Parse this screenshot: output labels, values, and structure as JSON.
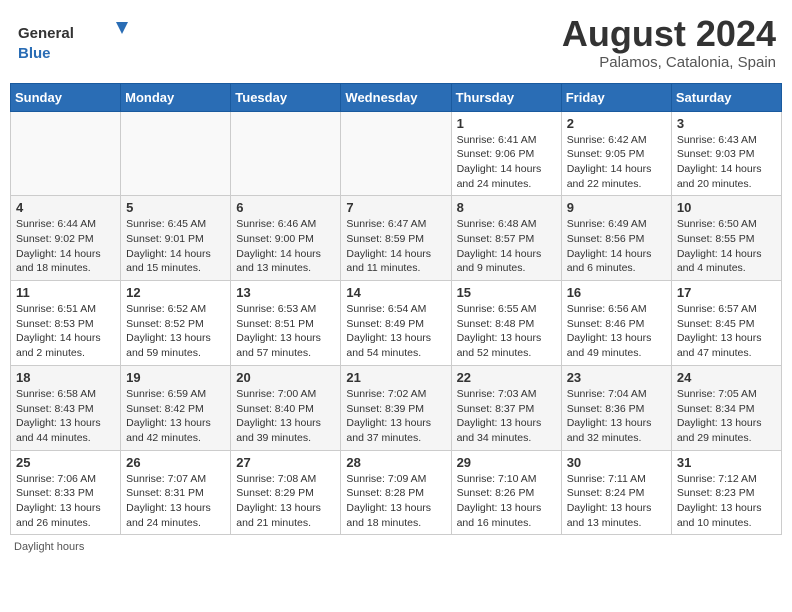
{
  "header": {
    "logo_general": "General",
    "logo_blue": "Blue",
    "month_year": "August 2024",
    "location": "Palamos, Catalonia, Spain"
  },
  "footer": {
    "daylight_label": "Daylight hours"
  },
  "days_of_week": [
    "Sunday",
    "Monday",
    "Tuesday",
    "Wednesday",
    "Thursday",
    "Friday",
    "Saturday"
  ],
  "weeks": [
    [
      {
        "num": "",
        "info": "",
        "empty": true
      },
      {
        "num": "",
        "info": "",
        "empty": true
      },
      {
        "num": "",
        "info": "",
        "empty": true
      },
      {
        "num": "",
        "info": "",
        "empty": true
      },
      {
        "num": "1",
        "info": "Sunrise: 6:41 AM\nSunset: 9:06 PM\nDaylight: 14 hours\nand 24 minutes.",
        "empty": false
      },
      {
        "num": "2",
        "info": "Sunrise: 6:42 AM\nSunset: 9:05 PM\nDaylight: 14 hours\nand 22 minutes.",
        "empty": false
      },
      {
        "num": "3",
        "info": "Sunrise: 6:43 AM\nSunset: 9:03 PM\nDaylight: 14 hours\nand 20 minutes.",
        "empty": false
      }
    ],
    [
      {
        "num": "4",
        "info": "Sunrise: 6:44 AM\nSunset: 9:02 PM\nDaylight: 14 hours\nand 18 minutes.",
        "empty": false
      },
      {
        "num": "5",
        "info": "Sunrise: 6:45 AM\nSunset: 9:01 PM\nDaylight: 14 hours\nand 15 minutes.",
        "empty": false
      },
      {
        "num": "6",
        "info": "Sunrise: 6:46 AM\nSunset: 9:00 PM\nDaylight: 14 hours\nand 13 minutes.",
        "empty": false
      },
      {
        "num": "7",
        "info": "Sunrise: 6:47 AM\nSunset: 8:59 PM\nDaylight: 14 hours\nand 11 minutes.",
        "empty": false
      },
      {
        "num": "8",
        "info": "Sunrise: 6:48 AM\nSunset: 8:57 PM\nDaylight: 14 hours\nand 9 minutes.",
        "empty": false
      },
      {
        "num": "9",
        "info": "Sunrise: 6:49 AM\nSunset: 8:56 PM\nDaylight: 14 hours\nand 6 minutes.",
        "empty": false
      },
      {
        "num": "10",
        "info": "Sunrise: 6:50 AM\nSunset: 8:55 PM\nDaylight: 14 hours\nand 4 minutes.",
        "empty": false
      }
    ],
    [
      {
        "num": "11",
        "info": "Sunrise: 6:51 AM\nSunset: 8:53 PM\nDaylight: 14 hours\nand 2 minutes.",
        "empty": false
      },
      {
        "num": "12",
        "info": "Sunrise: 6:52 AM\nSunset: 8:52 PM\nDaylight: 13 hours\nand 59 minutes.",
        "empty": false
      },
      {
        "num": "13",
        "info": "Sunrise: 6:53 AM\nSunset: 8:51 PM\nDaylight: 13 hours\nand 57 minutes.",
        "empty": false
      },
      {
        "num": "14",
        "info": "Sunrise: 6:54 AM\nSunset: 8:49 PM\nDaylight: 13 hours\nand 54 minutes.",
        "empty": false
      },
      {
        "num": "15",
        "info": "Sunrise: 6:55 AM\nSunset: 8:48 PM\nDaylight: 13 hours\nand 52 minutes.",
        "empty": false
      },
      {
        "num": "16",
        "info": "Sunrise: 6:56 AM\nSunset: 8:46 PM\nDaylight: 13 hours\nand 49 minutes.",
        "empty": false
      },
      {
        "num": "17",
        "info": "Sunrise: 6:57 AM\nSunset: 8:45 PM\nDaylight: 13 hours\nand 47 minutes.",
        "empty": false
      }
    ],
    [
      {
        "num": "18",
        "info": "Sunrise: 6:58 AM\nSunset: 8:43 PM\nDaylight: 13 hours\nand 44 minutes.",
        "empty": false
      },
      {
        "num": "19",
        "info": "Sunrise: 6:59 AM\nSunset: 8:42 PM\nDaylight: 13 hours\nand 42 minutes.",
        "empty": false
      },
      {
        "num": "20",
        "info": "Sunrise: 7:00 AM\nSunset: 8:40 PM\nDaylight: 13 hours\nand 39 minutes.",
        "empty": false
      },
      {
        "num": "21",
        "info": "Sunrise: 7:02 AM\nSunset: 8:39 PM\nDaylight: 13 hours\nand 37 minutes.",
        "empty": false
      },
      {
        "num": "22",
        "info": "Sunrise: 7:03 AM\nSunset: 8:37 PM\nDaylight: 13 hours\nand 34 minutes.",
        "empty": false
      },
      {
        "num": "23",
        "info": "Sunrise: 7:04 AM\nSunset: 8:36 PM\nDaylight: 13 hours\nand 32 minutes.",
        "empty": false
      },
      {
        "num": "24",
        "info": "Sunrise: 7:05 AM\nSunset: 8:34 PM\nDaylight: 13 hours\nand 29 minutes.",
        "empty": false
      }
    ],
    [
      {
        "num": "25",
        "info": "Sunrise: 7:06 AM\nSunset: 8:33 PM\nDaylight: 13 hours\nand 26 minutes.",
        "empty": false
      },
      {
        "num": "26",
        "info": "Sunrise: 7:07 AM\nSunset: 8:31 PM\nDaylight: 13 hours\nand 24 minutes.",
        "empty": false
      },
      {
        "num": "27",
        "info": "Sunrise: 7:08 AM\nSunset: 8:29 PM\nDaylight: 13 hours\nand 21 minutes.",
        "empty": false
      },
      {
        "num": "28",
        "info": "Sunrise: 7:09 AM\nSunset: 8:28 PM\nDaylight: 13 hours\nand 18 minutes.",
        "empty": false
      },
      {
        "num": "29",
        "info": "Sunrise: 7:10 AM\nSunset: 8:26 PM\nDaylight: 13 hours\nand 16 minutes.",
        "empty": false
      },
      {
        "num": "30",
        "info": "Sunrise: 7:11 AM\nSunset: 8:24 PM\nDaylight: 13 hours\nand 13 minutes.",
        "empty": false
      },
      {
        "num": "31",
        "info": "Sunrise: 7:12 AM\nSunset: 8:23 PM\nDaylight: 13 hours\nand 10 minutes.",
        "empty": false
      }
    ]
  ]
}
